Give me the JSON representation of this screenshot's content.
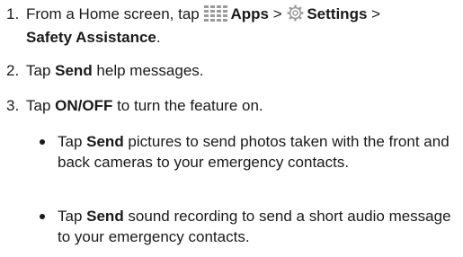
{
  "steps": [
    {
      "num": "1.",
      "pre": "From a Home screen, tap ",
      "apps": "Apps",
      "sep1": " > ",
      "settings": "Settings",
      "sep2": " >",
      "safety": "Safety Assistance",
      "end": "."
    },
    {
      "num": "2.",
      "pre": "Tap ",
      "bold": "Send",
      "post": " help messages."
    },
    {
      "num": "3.",
      "pre": "Tap ",
      "bold": "ON/OFF",
      "post": " to turn the feature on."
    }
  ],
  "bullets": [
    {
      "pre": "Tap ",
      "bold": "Send",
      "post": " pictures to send photos taken with the front and back cameras to your emergency contacts."
    },
    {
      "pre": "Tap ",
      "bold": "Send",
      "post": " sound recording to send a short audio message to your emergency contacts."
    }
  ],
  "icons": [
    "apps-grid-icon",
    "settings-gear-icon"
  ],
  "colors": {
    "text": "#1a1a1a",
    "icon_gray": "#9a9a9a"
  }
}
